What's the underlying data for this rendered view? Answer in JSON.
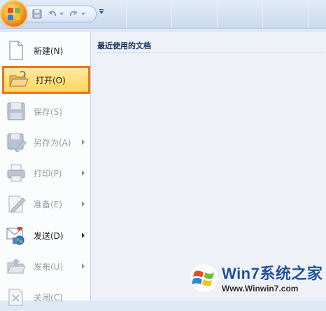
{
  "menu": {
    "items": [
      {
        "label": "新建(N)",
        "enabled": true,
        "submenu": false,
        "icon": "new-document-icon"
      },
      {
        "label": "打开(O)",
        "enabled": true,
        "submenu": false,
        "icon": "open-folder-icon",
        "selected": true
      },
      {
        "label": "保存(S)",
        "enabled": false,
        "submenu": false,
        "icon": "save-disk-icon"
      },
      {
        "label": "另存为(A)",
        "enabled": false,
        "submenu": true,
        "icon": "save-as-icon"
      },
      {
        "label": "打印(P)",
        "enabled": false,
        "submenu": true,
        "icon": "printer-icon"
      },
      {
        "label": "准备(E)",
        "enabled": false,
        "submenu": true,
        "icon": "prepare-icon"
      },
      {
        "label": "发送(D)",
        "enabled": true,
        "submenu": true,
        "icon": "send-icon"
      },
      {
        "label": "发布(U)",
        "enabled": false,
        "submenu": true,
        "icon": "publish-icon"
      },
      {
        "label": "关闭(C)",
        "enabled": false,
        "submenu": false,
        "icon": "close-document-icon"
      }
    ]
  },
  "recent": {
    "title": "最近使用的文档"
  },
  "watermark": {
    "brand": "Win7系统之家",
    "url": "Www.Winwin7.com"
  },
  "colors": {
    "accent": "#e8781b",
    "selected_bg": "#ffd75e"
  }
}
